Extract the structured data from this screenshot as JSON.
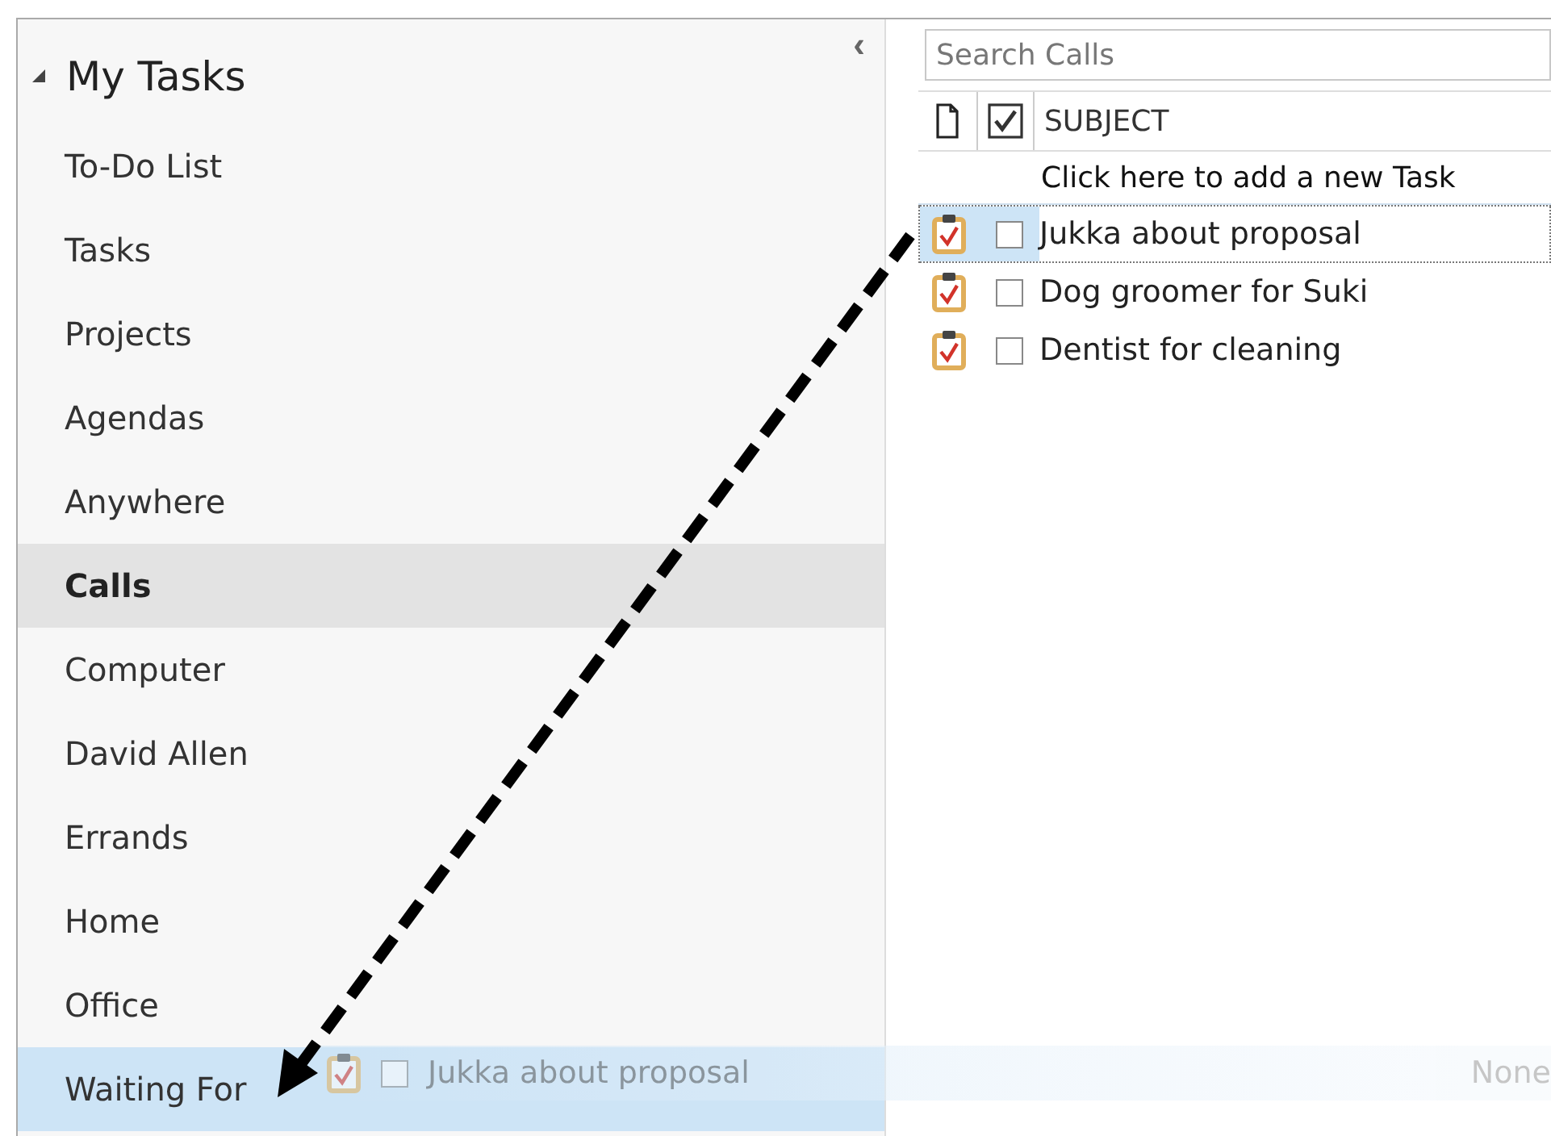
{
  "sidebar": {
    "collapse_glyph": "‹",
    "header": {
      "title": "My Tasks",
      "expanded": true
    },
    "items": [
      {
        "label": "To-Do List",
        "selected": false,
        "drop_target": false
      },
      {
        "label": "Tasks",
        "selected": false,
        "drop_target": false
      },
      {
        "label": "Projects",
        "selected": false,
        "drop_target": false
      },
      {
        "label": "Agendas",
        "selected": false,
        "drop_target": false
      },
      {
        "label": "Anywhere",
        "selected": false,
        "drop_target": false
      },
      {
        "label": "Calls",
        "selected": true,
        "drop_target": false
      },
      {
        "label": "Computer",
        "selected": false,
        "drop_target": false
      },
      {
        "label": "David Allen",
        "selected": false,
        "drop_target": false
      },
      {
        "label": "Errands",
        "selected": false,
        "drop_target": false
      },
      {
        "label": "Home",
        "selected": false,
        "drop_target": false
      },
      {
        "label": "Office",
        "selected": false,
        "drop_target": false
      },
      {
        "label": "Waiting For",
        "selected": false,
        "drop_target": true
      }
    ]
  },
  "search": {
    "placeholder": "Search Calls"
  },
  "table": {
    "columns": [
      {
        "kind": "icon"
      },
      {
        "kind": "complete"
      },
      {
        "kind": "text",
        "label": "SUBJECT"
      }
    ],
    "new_row": "Click here to add a new Task",
    "rows": [
      {
        "subject": "Jukka about proposal",
        "checked": false,
        "selected": true
      },
      {
        "subject": "Dog groomer for Suki",
        "checked": false,
        "selected": false
      },
      {
        "subject": "Dentist for cleaning",
        "checked": false,
        "selected": false
      }
    ]
  },
  "drag_ghost": {
    "subject": "Jukka about proposal",
    "checked": false,
    "column_3": "None"
  }
}
